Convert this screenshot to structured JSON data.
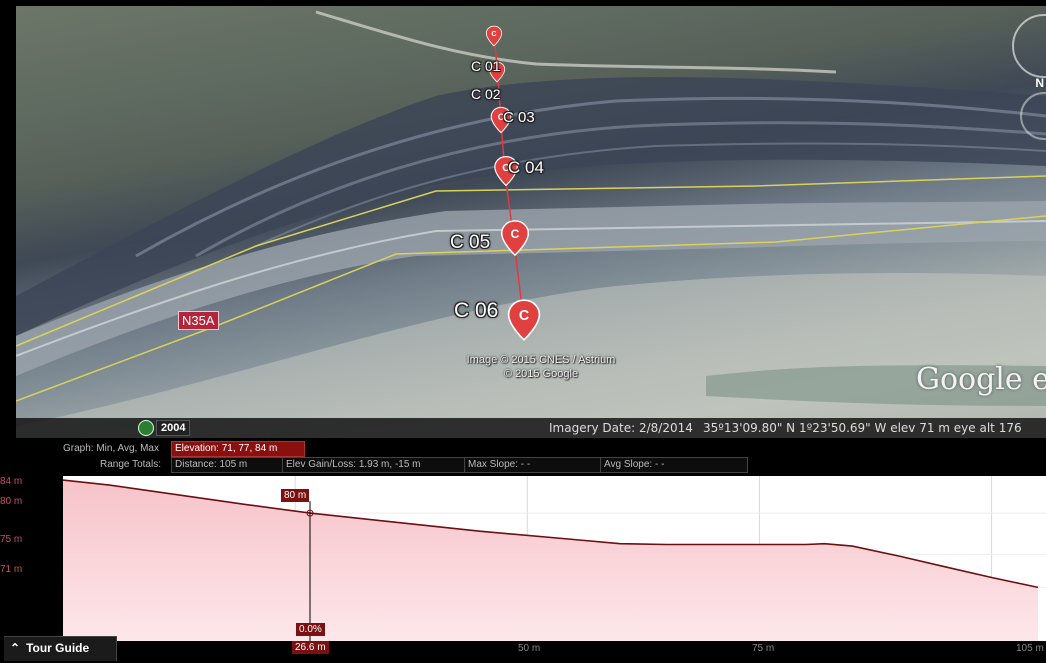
{
  "map": {
    "placemarks": [
      {
        "label": "C 01"
      },
      {
        "label": "C 02"
      },
      {
        "label": "C 03"
      },
      {
        "label": "C 04"
      },
      {
        "label": "C 05"
      },
      {
        "label": "C 06"
      }
    ],
    "pin_glyph": "C",
    "road_label": "N35A",
    "attribution_line1": "Image © 2015 CNES / Astrium",
    "attribution_line2": "© 2015 Google",
    "logo": "Google ea",
    "compass_letter": "N"
  },
  "status_bar": {
    "year": "2004",
    "imagery_date": "Imagery Date: 2/8/2014",
    "coordinates": "35º13'09.80\" N   1º23'50.69\" W  elev   71 m    eye alt  176"
  },
  "elevation_profile": {
    "graph_label": "Graph: Min, Avg, Max",
    "elevation": "Elevation: 71, 77, 84 m",
    "range_totals_label": "Range Totals:",
    "distance": "Distance: 105 m",
    "elev_gain_loss": "Elev Gain/Loss: 1.93 m, -15 m",
    "max_slope": "Max Slope: - -",
    "avg_slope": "Avg Slope: - -",
    "y_ticks": [
      "84 m",
      "80 m",
      "75 m",
      "71 m"
    ],
    "x_ticks": [
      "50 m",
      "75 m",
      "105 m"
    ],
    "cursor_elevation": "80 m",
    "cursor_slope": "0.0%",
    "cursor_distance": "26.6 m",
    "tour_guide": "Tour Guide",
    "colors": {
      "line": "#6e0f12",
      "fill_top": "#f7c6cb",
      "fill_bottom": "#fbe3e5",
      "marker": "#7a1010"
    }
  },
  "chart_data": {
    "type": "area",
    "x": [
      0,
      5,
      10,
      15,
      20,
      26.6,
      35,
      45,
      55,
      60,
      65,
      70,
      75,
      80,
      82,
      85,
      90,
      95,
      100,
      105
    ],
    "series": [
      {
        "values": [
          84,
          83.4,
          82.6,
          81.8,
          81,
          80,
          79,
          77.8,
          76.8,
          76.3,
          76.2,
          76.2,
          76.2,
          76.2,
          76.3,
          76,
          74.8,
          73.5,
          72.2,
          71
        ]
      }
    ],
    "ylim": [
      64.5,
      84.5
    ],
    "xlim": [
      0,
      105
    ],
    "y_ticks": [
      "84 m",
      "80 m",
      "75 m",
      "71 m"
    ],
    "x_ticks": [
      "50 m",
      "75 m",
      "105 m"
    ],
    "grid": true
  }
}
